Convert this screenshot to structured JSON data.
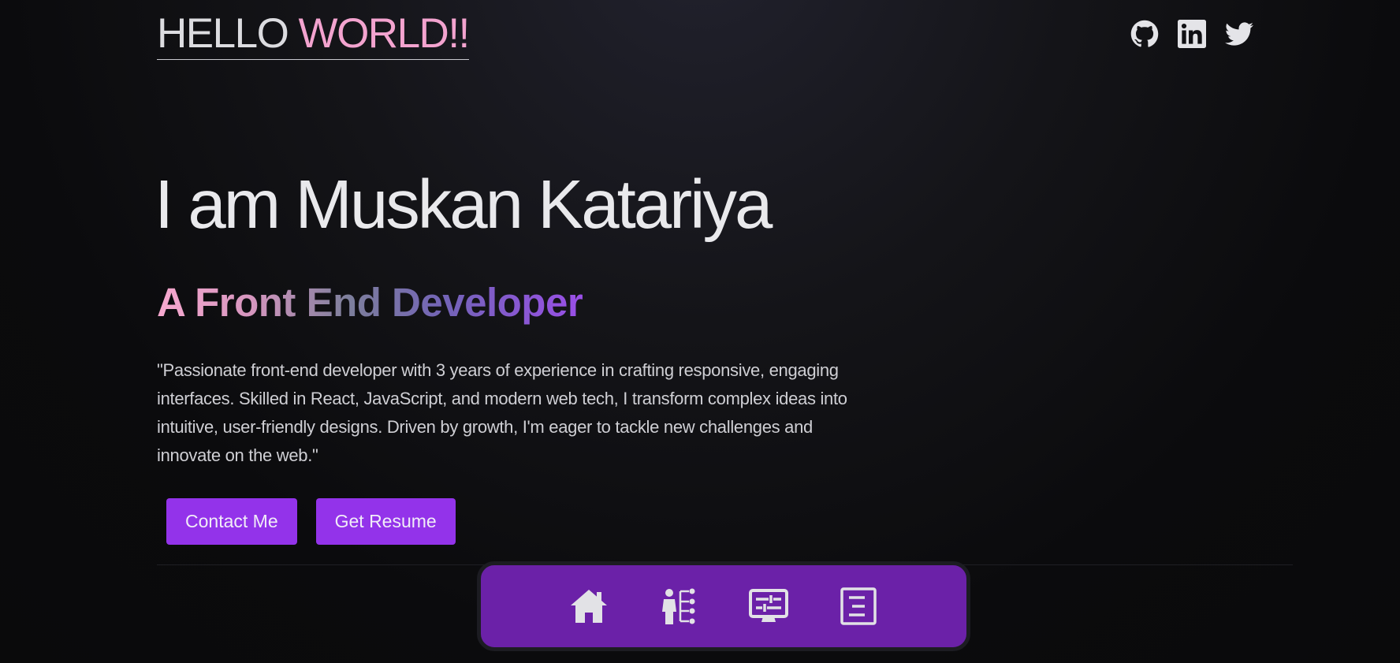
{
  "header": {
    "logo_first": "HELLO",
    "logo_accent": "WORLD!!",
    "socials": [
      {
        "icon": "github-icon"
      },
      {
        "icon": "linkedin-icon"
      },
      {
        "icon": "twitter-icon"
      }
    ]
  },
  "hero": {
    "title": "I am Muskan Katariya",
    "role": "A Front End Developer",
    "bio": "\"Passionate front-end developer with 3 years of experience in crafting responsive, engaging interfaces. Skilled in React, JavaScript, and modern web tech, I transform complex ideas into intuitive, user-friendly designs. Driven by growth, I'm eager to tackle new challenges and innovate on the web.\"",
    "contact_label": "Contact Me",
    "resume_label": "Get Resume"
  },
  "dock": {
    "items": [
      {
        "icon": "home-icon"
      },
      {
        "icon": "skills-icon"
      },
      {
        "icon": "projects-icon"
      },
      {
        "icon": "resume-icon"
      }
    ]
  },
  "colors": {
    "accent_pink": "#f3a3cf",
    "button_purple": "#9333ea",
    "dock_purple": "#6b21a8",
    "background": "#0a0a0b"
  }
}
